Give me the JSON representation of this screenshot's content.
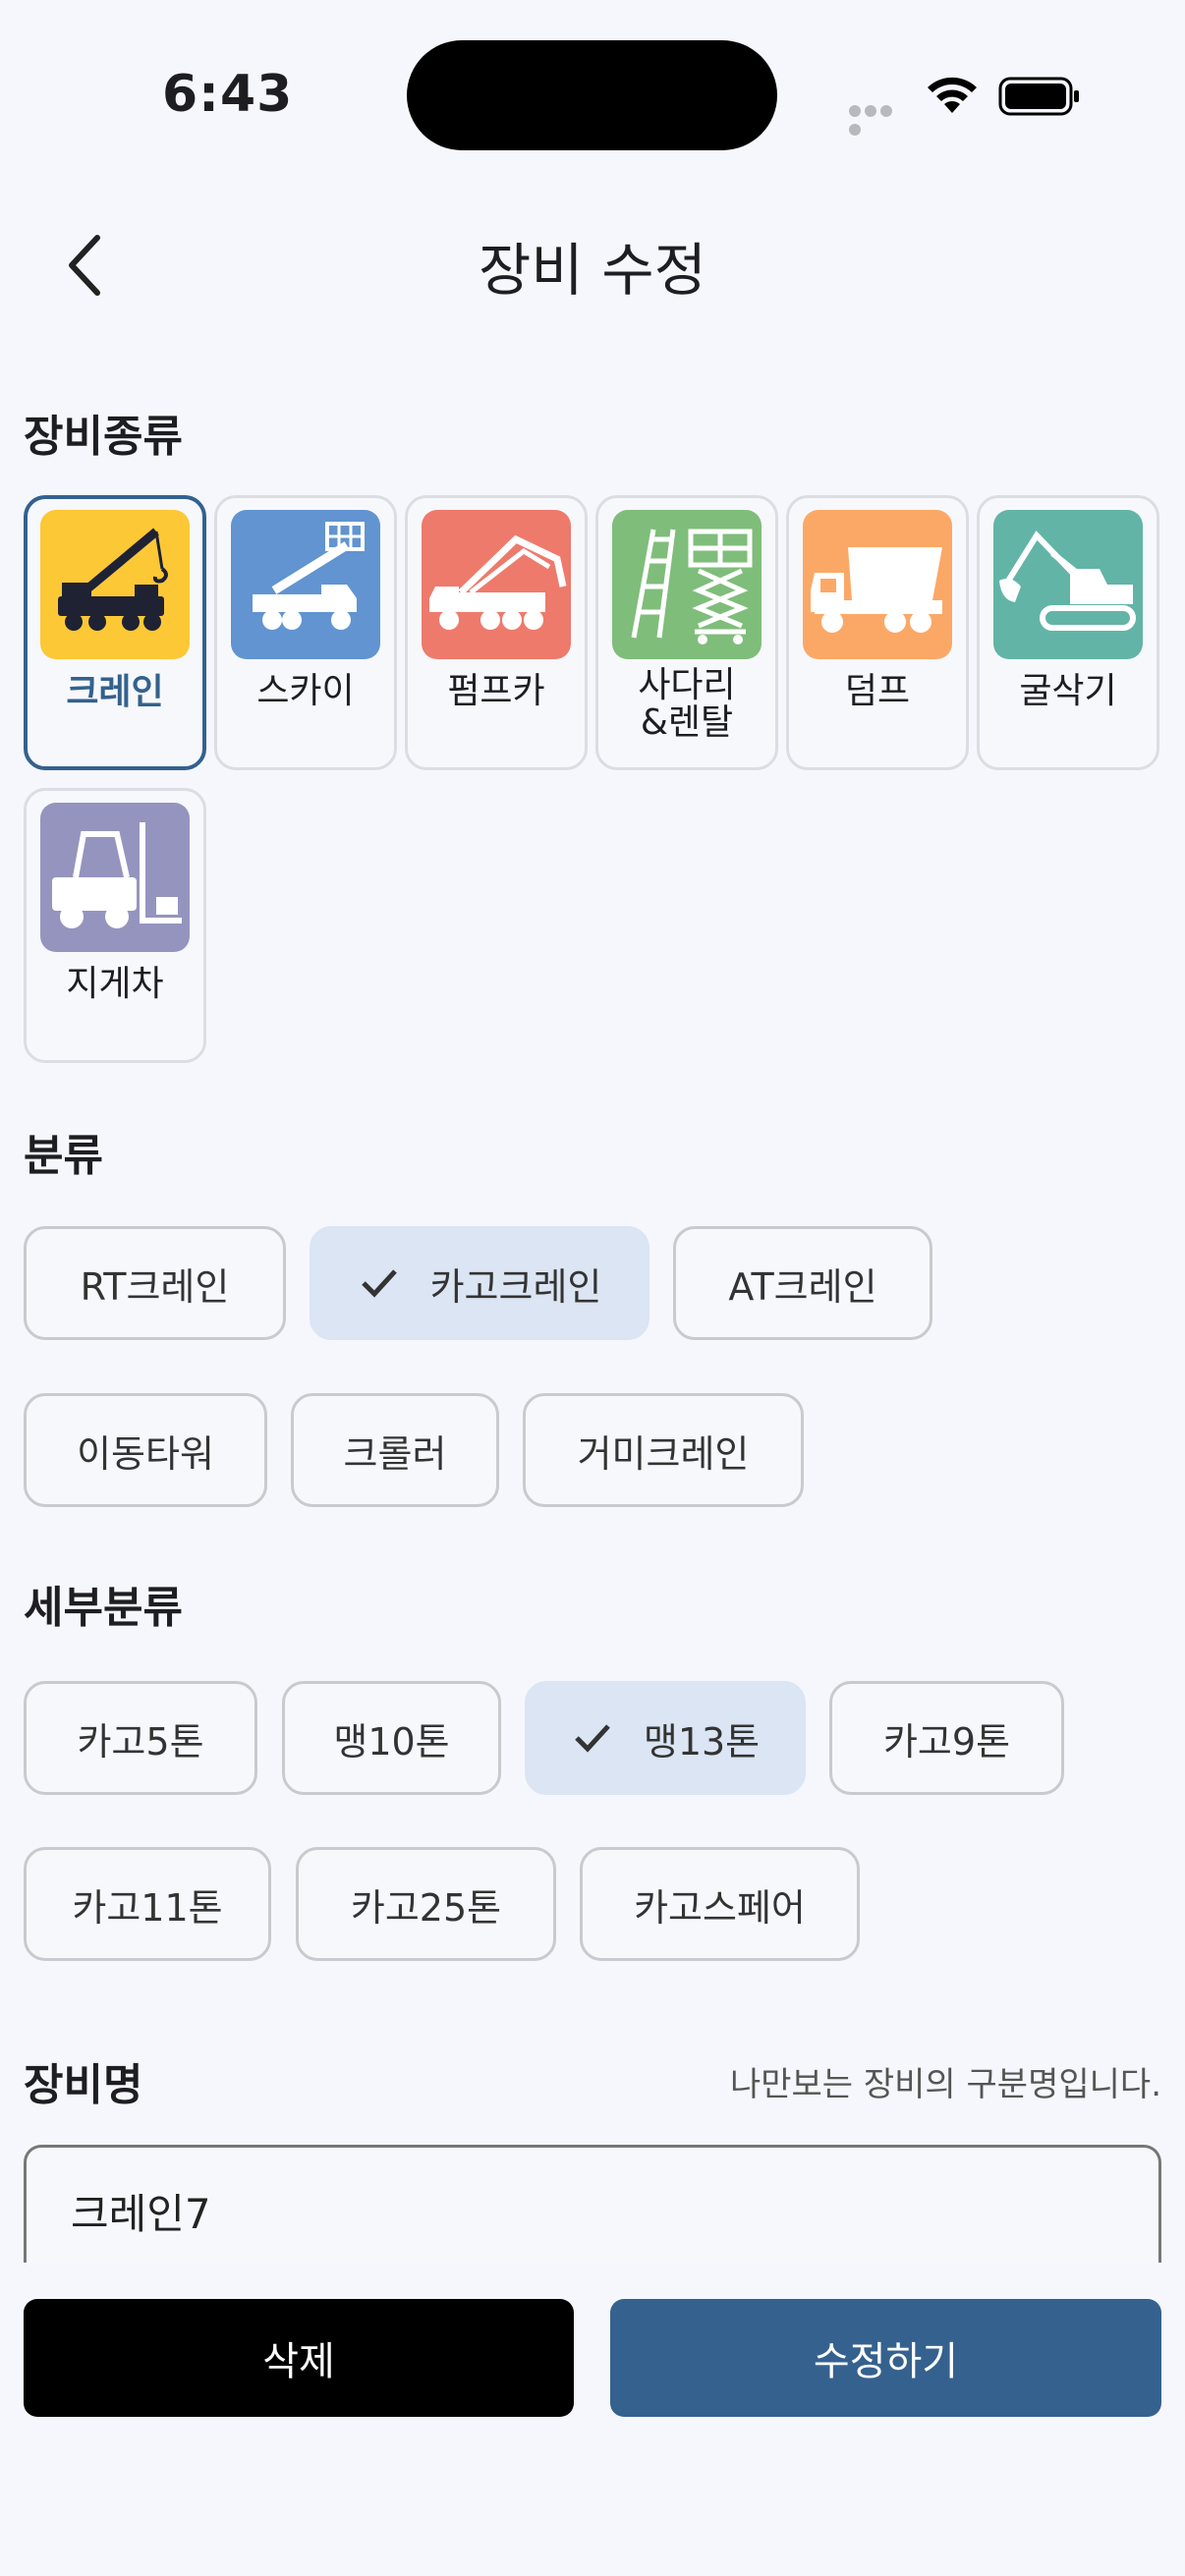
{
  "status_bar": {
    "time": "6:43"
  },
  "header": {
    "title": "장비 수정"
  },
  "equipment_type": {
    "label": "장비종류",
    "items": [
      {
        "label": "크레인",
        "icon": "crane-icon",
        "color": "#fdc836",
        "selected": true
      },
      {
        "label": "스카이",
        "icon": "sky-lift-truck-icon",
        "color": "#6194d0",
        "selected": false
      },
      {
        "label": "펌프카",
        "icon": "pump-truck-icon",
        "color": "#ee7a6c",
        "selected": false
      },
      {
        "label": "사다리\n&렌탈",
        "icon": "ladder-scissor-lift-icon",
        "color": "#7fbd7b",
        "selected": false
      },
      {
        "label": "덤프",
        "icon": "dump-truck-icon",
        "color": "#fba866",
        "selected": false
      },
      {
        "label": "굴삭기",
        "icon": "excavator-icon",
        "color": "#62b4a7",
        "selected": false
      },
      {
        "label": "지게차",
        "icon": "forklift-icon",
        "color": "#9594bf",
        "selected": false
      }
    ]
  },
  "category": {
    "label": "분류",
    "options": [
      "RT크레인",
      "카고크레인",
      "AT크레인",
      "이동타워",
      "크롤러",
      "거미크레인"
    ],
    "selected": "카고크레인"
  },
  "subcategory": {
    "label": "세부분류",
    "options": [
      "카고5톤",
      "맹10톤",
      "맹13톤",
      "카고9톤",
      "카고11톤",
      "카고25톤",
      "카고스페어"
    ],
    "selected": "맹13톤"
  },
  "equipment_name": {
    "label": "장비명",
    "hint": "나만보는 장비의 구분명입니다.",
    "value": "크레인7"
  },
  "actions": {
    "delete_label": "삭제",
    "save_label": "수정하기"
  },
  "colors": {
    "accent": "#35618f",
    "chip_selected": "#dbe5f3"
  }
}
